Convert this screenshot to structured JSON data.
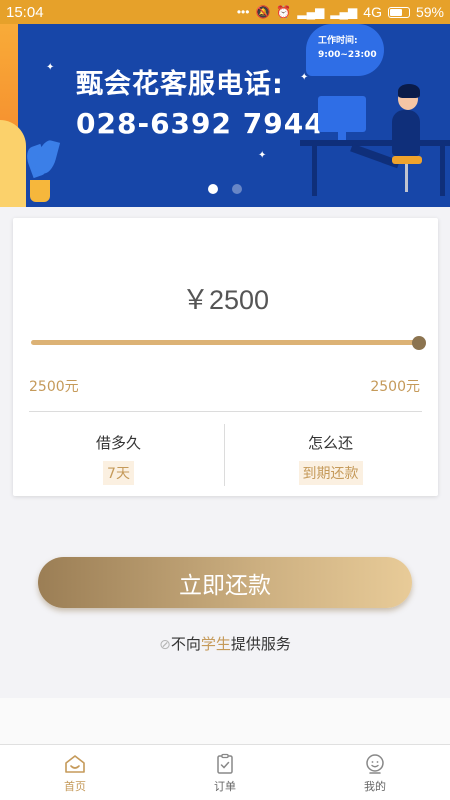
{
  "status_bar": {
    "time": "15:04",
    "network": "4G",
    "battery": "59%"
  },
  "banner": {
    "hotline_title": "甄会花客服电话:",
    "hotline_number": "028-6392 7944",
    "work_hours_label": "工作时间:",
    "work_hours": "9:00~23:00",
    "slides": 2,
    "active_slide": 0
  },
  "loan_card": {
    "amount": "￥2500",
    "slider_fraction": 1.0,
    "range_min": "2500元",
    "range_max": "2500元",
    "term_title": "借多久",
    "term_value": "7天",
    "repay_title": "怎么还",
    "repay_value": "到期还款"
  },
  "action": {
    "repay_button": "立即还款",
    "notice_prefix": "不向",
    "notice_highlight": "学生",
    "notice_suffix": "提供服务"
  },
  "tabbar": {
    "items": [
      {
        "label": "首页",
        "icon": "home-icon",
        "active": true
      },
      {
        "label": "订单",
        "icon": "clipboard-icon",
        "active": false
      },
      {
        "label": "我的",
        "icon": "user-icon",
        "active": false
      }
    ]
  },
  "colors": {
    "accent_gold": "#c59a5a",
    "banner_blue": "#1746a8",
    "status_bar": "#e6a12a"
  }
}
